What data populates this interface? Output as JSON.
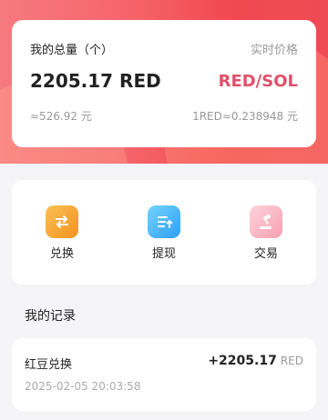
{
  "summary": {
    "total_label": "我的总量（个）",
    "realtime_label": "实时价格",
    "amount": "2205.17 RED",
    "pair": "RED/SOL",
    "approx_value": "≈526.92 元",
    "rate": "1RED≈0.238948 元"
  },
  "actions": [
    {
      "label": "兑换",
      "icon": "exchange-icon",
      "color": "#f2931e"
    },
    {
      "label": "提现",
      "icon": "withdraw-icon",
      "color": "#2f9ff3"
    },
    {
      "label": "交易",
      "icon": "auction-gavel-icon",
      "color": "#f6a0b0"
    }
  ],
  "records": {
    "title": "我的记录",
    "items": [
      {
        "title": "红豆兑换",
        "amount": "+2205.17",
        "unit": "RED",
        "time": "2025-02-05 20:03:58"
      }
    ]
  },
  "colors": {
    "header_gradient": "#f5646a",
    "pair_accent": "#e0506a"
  }
}
